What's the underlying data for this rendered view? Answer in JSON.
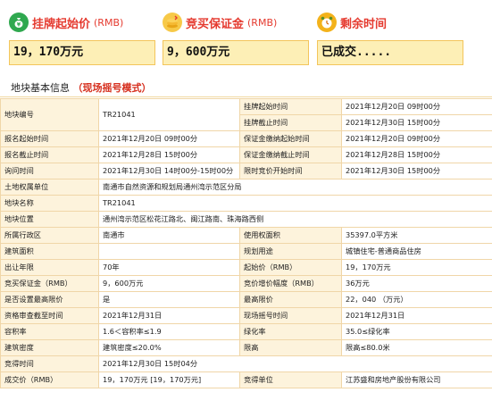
{
  "panels": {
    "start_price": {
      "label": "挂牌起始价",
      "unit": "(RMB)",
      "value": "19，170万元",
      "icon": "money-bag-icon"
    },
    "deposit": {
      "label": "竞买保证金",
      "unit": "(RMB)",
      "value": "9，600万元",
      "icon": "coins-stack-icon"
    },
    "remaining": {
      "label": "剩余时间",
      "unit": "",
      "value": "已成交.....",
      "icon": "alarm-clock-icon"
    }
  },
  "section": {
    "title": "地块基本信息",
    "mode": "（现场摇号模式）"
  },
  "table": {
    "parcel_code_label": "地块编号",
    "parcel_code_value": "TR21041",
    "listing_start_label": "挂牌起始时间",
    "listing_start_value": "2021年12月20日 09时00分",
    "listing_end_label": "挂牌截止时间",
    "listing_end_value": "2021年12月30日 15时00分",
    "rows": [
      [
        "报名起始时间",
        "2021年12月20日 09时00分",
        "保证金缴纳起始时间",
        "2021年12月20日 09时00分"
      ],
      [
        "报名截止时间",
        "2021年12月28日 15时00分",
        "保证金缴纳截止时间",
        "2021年12月28日 15时00分"
      ],
      [
        "询问时间",
        "2021年12月30日 14时00分-15时00分",
        "限时竞价开始时间",
        "2021年12月30日 15时00分"
      ]
    ],
    "full_rows": [
      [
        "土地权属单位",
        "南通市自然资源和规划局通州湾示范区分局"
      ],
      [
        "地块名称",
        "TR21041"
      ],
      [
        "地块位置",
        "通州湾示范区松花江路北、闽江路南、珠海路西侧"
      ]
    ],
    "rows2": [
      [
        "所属行政区",
        "南通市",
        "使用权面积",
        "35397.0平方米"
      ],
      [
        "建筑面积",
        "",
        "规划用途",
        "城镇住宅-普通商品住房"
      ],
      [
        "出让年限",
        "70年",
        "起始价（RMB）",
        "19，170万元"
      ],
      [
        "竞买保证金（RMB）",
        "9，600万元",
        "竞价增价幅度（RMB）",
        "36万元"
      ],
      [
        "是否设置最高限价",
        "是",
        "最高限价",
        "22，040 （万元）"
      ],
      [
        "资格审查截至时间",
        "2021年12月31日",
        "现场摇号时间",
        "2021年12月31日"
      ],
      [
        "容积率",
        "1.6＜容积率≤1.9",
        "绿化率",
        "35.0≤绿化率"
      ],
      [
        "建筑密度",
        "建筑密度≤20.0%",
        "限高",
        "限高≤80.0米"
      ]
    ],
    "deal_time_label": "竞得时间",
    "deal_time_value": "2021年12月30日 15时04分",
    "deal_price_label": "成交价（RMB）",
    "deal_price_value": "19，170万元 [19，170万元]",
    "winner_label": "竞得单位",
    "winner_value": "江苏盛和房地产股份有限公司"
  },
  "colors": {
    "accent_red": "#e53a2f",
    "value_box_bg": "#fdefb6",
    "value_box_border": "#f3c55b",
    "table_border": "#f0d6a8",
    "label_cell_bg": "#fdf3dc"
  }
}
